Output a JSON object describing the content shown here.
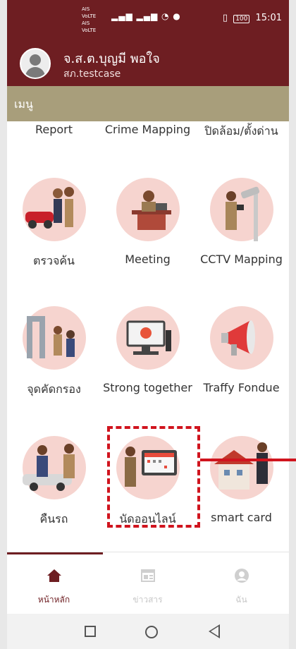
{
  "status": {
    "carrier1": "AIS",
    "carrier2": "AIS",
    "volte": "VoLTE",
    "battery": "100",
    "time": "15:01"
  },
  "user": {
    "name": "จ.ส.ต.บุญมี พอใจ",
    "sub": "สภ.testcase"
  },
  "menu": {
    "title": "เมนู"
  },
  "grid": {
    "row0": [
      "Report",
      "Crime Mapping",
      "ปิดล้อม/ตั้งด่าน"
    ],
    "row1": [
      "ตรวจค้น",
      "Meeting",
      "CCTV Mapping"
    ],
    "row2": [
      "จุดคัดกรอง",
      "Strong together",
      "Traffy Fondue"
    ],
    "row3": [
      "คืนรถ",
      "นัดออนไลน์",
      "smart card"
    ]
  },
  "nav": {
    "home": "หน้าหลัก",
    "news": "ข่าวสาร",
    "me": "ฉัน"
  },
  "colors": {
    "brand": "#6e1e22",
    "menu_bar": "#a89e7b",
    "highlight": "#d0141e",
    "illus_bg": "#f6d4cf"
  }
}
